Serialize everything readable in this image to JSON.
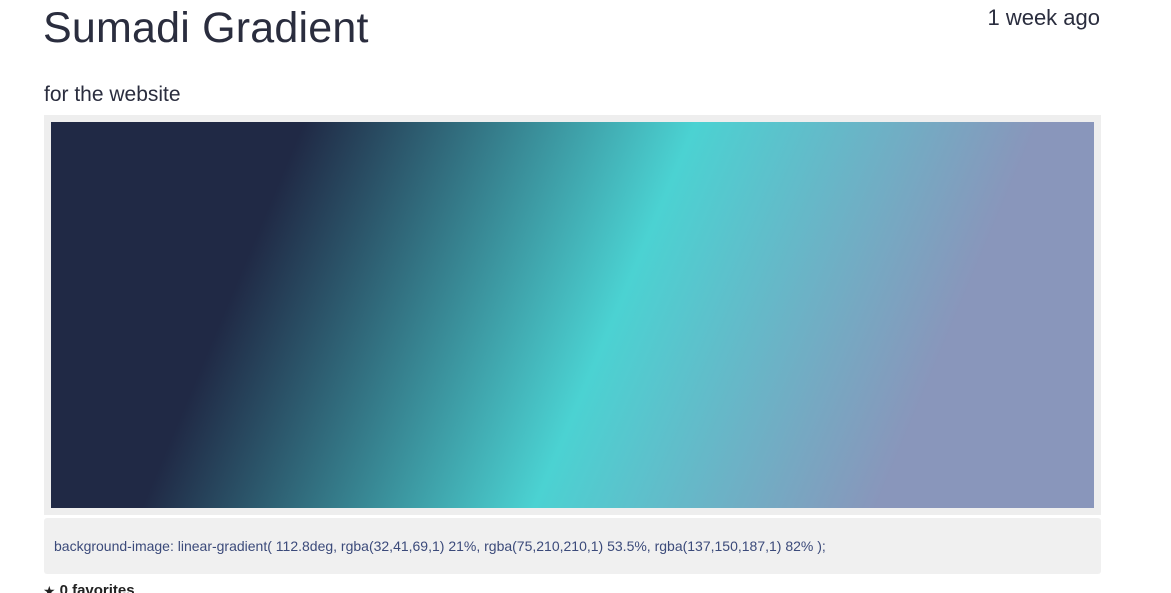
{
  "header": {
    "title": "Sumadi Gradient",
    "time_ago": "1 week ago"
  },
  "description": "for the website",
  "gradient": {
    "angle_deg": 112.8,
    "stops": [
      {
        "color": "rgba(32,41,69,1)",
        "position": "21%"
      },
      {
        "color": "rgba(75,210,210,1)",
        "position": "53.5%"
      },
      {
        "color": "rgba(137,150,187,1)",
        "position": "82%"
      }
    ]
  },
  "code": {
    "text": "background-image: linear-gradient( 112.8deg, rgba(32,41,69,1) 21%, rgba(75,210,210,1) 53.5%, rgba(137,150,187,1) 82% );"
  },
  "favorites": {
    "icon": "star-icon",
    "star_glyph": "★",
    "label": "0 favorites"
  }
}
